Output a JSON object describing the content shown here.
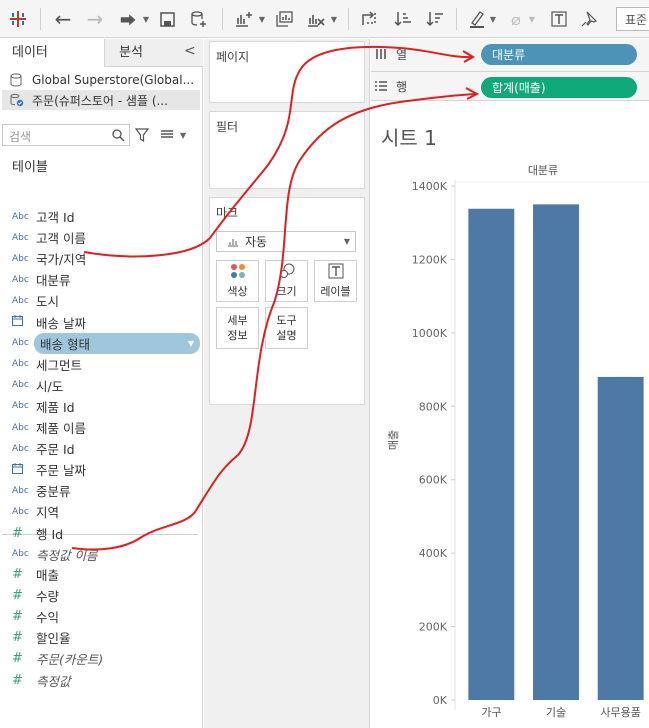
{
  "colors": {
    "dimension_pill": "#4b94b8",
    "measure_pill": "#0fa97a",
    "bar": "#4e79a7",
    "annotation": "#e02020",
    "selected_field": "#9fc6dc"
  },
  "toolbar": {
    "right_label": "표준"
  },
  "left_pane": {
    "tabs": [
      {
        "label": "데이터"
      },
      {
        "label": "분석"
      }
    ],
    "collapse": "<",
    "datasources": [
      {
        "label": "Global Superstore(Global..."
      },
      {
        "label": "주문(슈퍼스토어 - 샘플 (..."
      }
    ],
    "search": {
      "placeholder": "검색"
    },
    "section_title": "테이블",
    "fields": [
      {
        "type": "Abc",
        "label": "고객 Id"
      },
      {
        "type": "Abc",
        "label": "고객 이름"
      },
      {
        "type": "Abc",
        "label": "국가/지역"
      },
      {
        "type": "Abc",
        "label": "대분류"
      },
      {
        "type": "Abc",
        "label": "도시"
      },
      {
        "type": "date",
        "label": "배송 날짜"
      },
      {
        "type": "Abc",
        "label": "배송 형태"
      },
      {
        "type": "Abc",
        "label": "세그먼트"
      },
      {
        "type": "Abc",
        "label": "시/도"
      },
      {
        "type": "Abc",
        "label": "제품 Id"
      },
      {
        "type": "Abc",
        "label": "제품 이름"
      },
      {
        "type": "Abc",
        "label": "주문 Id"
      },
      {
        "type": "date",
        "label": "주문 날짜"
      },
      {
        "type": "Abc",
        "label": "중분류"
      },
      {
        "type": "Abc",
        "label": "지역"
      },
      {
        "type": "#",
        "label": "행 Id"
      },
      {
        "type": "Abc",
        "label": "측정값 이름"
      },
      {
        "type": "#",
        "label": "매출"
      },
      {
        "type": "#",
        "label": "수량"
      },
      {
        "type": "#",
        "label": "수익"
      },
      {
        "type": "#",
        "label": "할인율"
      },
      {
        "type": "#",
        "label": "주문(카운트)"
      },
      {
        "type": "#",
        "label": "측정값"
      }
    ]
  },
  "shelves": {
    "pages": "페이지",
    "filters": "필터",
    "marks": {
      "title": "마크",
      "type_select": "자동",
      "buttons": [
        {
          "label": "색상"
        },
        {
          "label": "크기"
        },
        {
          "label": "레이블"
        },
        {
          "label": "세부\n정보"
        },
        {
          "label": "도구\n설명"
        }
      ]
    },
    "columns": {
      "label": "열",
      "pill": "대분류"
    },
    "rows": {
      "label": "행",
      "pill": "합계(매출)"
    }
  },
  "sheet": {
    "title": "시트 1"
  },
  "chart_data": {
    "type": "bar",
    "header": "대분류",
    "categories": [
      "가구",
      "기술",
      "사무용품"
    ],
    "values": [
      1338000,
      1350000,
      880000
    ],
    "ylim": [
      0,
      1400000
    ],
    "ylabel": "매출",
    "yticks": [
      "0K",
      "200K",
      "400K",
      "600K",
      "800K",
      "1000K",
      "1200K",
      "1400K"
    ],
    "ytick_values": [
      0,
      200000,
      400000,
      600000,
      800000,
      1000000,
      1200000,
      1400000
    ]
  }
}
